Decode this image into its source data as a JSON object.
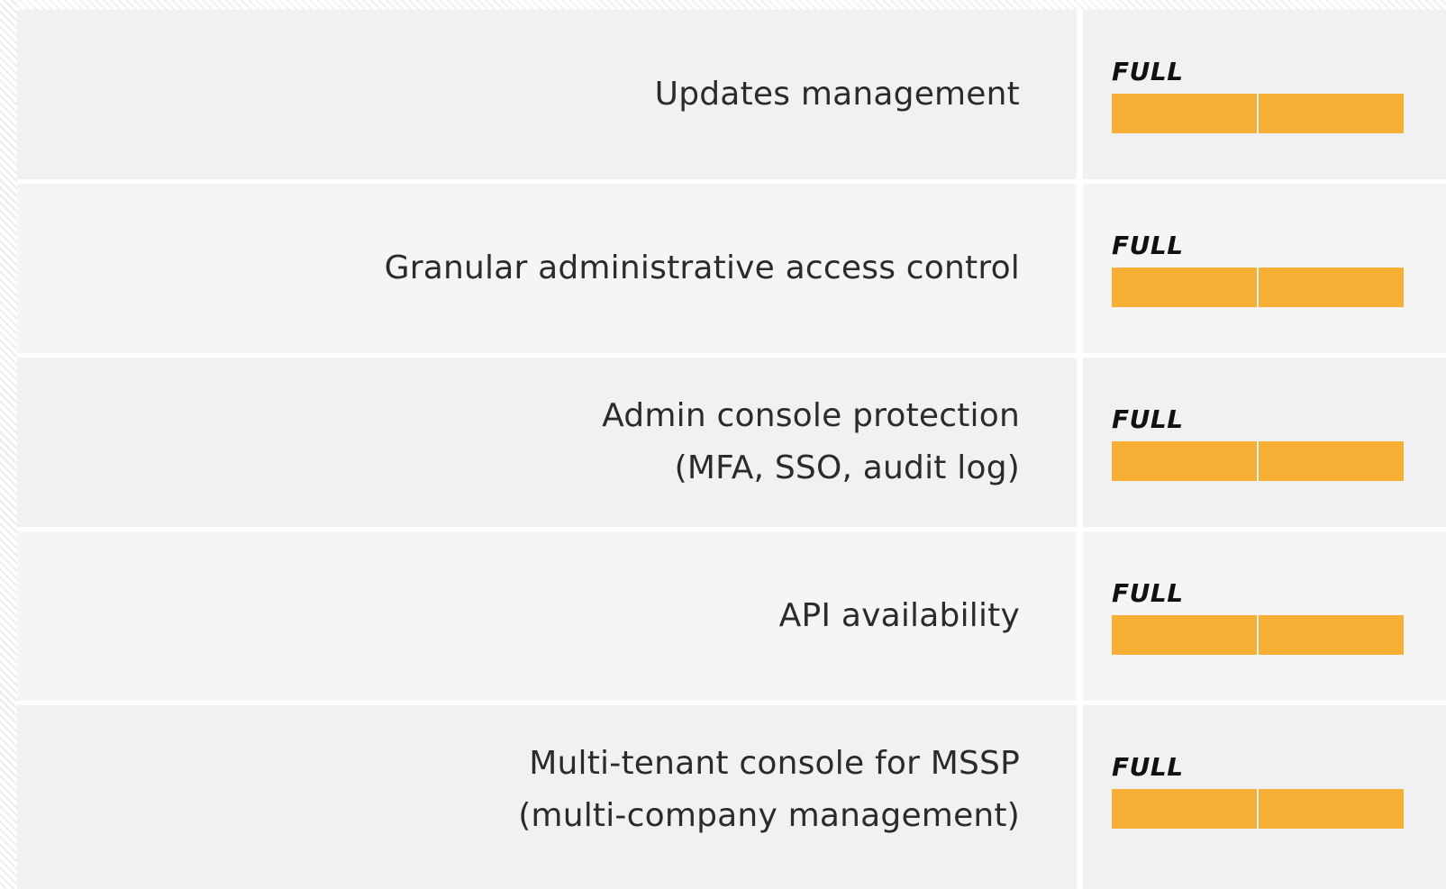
{
  "colors": {
    "bar_fill": "#f6ae35",
    "row_dark": "#f0f1f2",
    "row_light": "#f5f5f6",
    "label_text": "#2b2b2b",
    "rating_text": "#111111"
  },
  "rows": [
    {
      "feature": "Updates management",
      "rating": "FULL",
      "filled_segments": 2,
      "total_segments": 2
    },
    {
      "feature": "Granular administrative access control",
      "rating": "FULL",
      "filled_segments": 2,
      "total_segments": 2
    },
    {
      "feature": "Admin console protection\n(MFA, SSO, audit log)",
      "rating": "FULL",
      "filled_segments": 2,
      "total_segments": 2
    },
    {
      "feature": "API availability",
      "rating": "FULL",
      "filled_segments": 2,
      "total_segments": 2
    },
    {
      "feature": "Multi-tenant console for MSSP\n(multi-company management)",
      "rating": "FULL",
      "filled_segments": 2,
      "total_segments": 2
    }
  ]
}
